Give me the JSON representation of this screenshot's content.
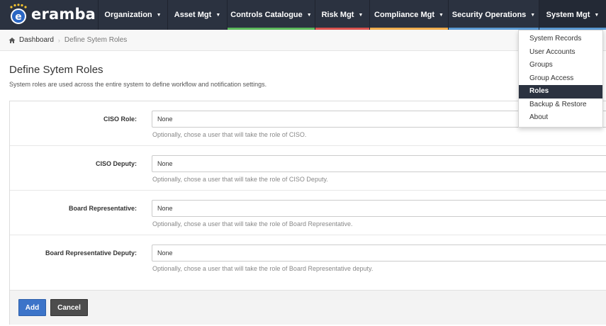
{
  "app": {
    "logo_text": "eramba"
  },
  "nav": {
    "items": [
      {
        "label": "Organization",
        "accent": ""
      },
      {
        "label": "Asset Mgt",
        "accent": ""
      },
      {
        "label": "Controls Catalogue",
        "accent": "#5cb85c"
      },
      {
        "label": "Risk Mgt",
        "accent": "#d9534f"
      },
      {
        "label": "Compliance Mgt",
        "accent": "#f0ad4e"
      },
      {
        "label": "Security Operations",
        "accent": "#5b9bd5"
      },
      {
        "label": "System Mgt",
        "accent": "#5b9bd5"
      }
    ]
  },
  "breadcrumb": {
    "home": "Dashboard",
    "current": "Define Sytem Roles"
  },
  "page": {
    "title": "Define Sytem Roles",
    "description": "System roles are used across the entire system to define workflow and notification settings."
  },
  "form": {
    "fields": [
      {
        "label": "CISO Role:",
        "value": "None",
        "help": "Optionally, chose a user that will take the role of CISO."
      },
      {
        "label": "CISO Deputy:",
        "value": "None",
        "help": "Optionally, chose a user that will take the role of CISO Deputy."
      },
      {
        "label": "Board Representative:",
        "value": "None",
        "help": "Optionally, chose a user that will take the role of Board Representative."
      },
      {
        "label": "Board Representative Deputy:",
        "value": "None",
        "help": "Optionally, chose a user that will take the role of Board Representative deputy."
      }
    ],
    "add_label": "Add",
    "cancel_label": "Cancel"
  },
  "dropdown": {
    "items": [
      "System Records",
      "User Accounts",
      "Groups",
      "Group Access",
      "Roles",
      "Backup & Restore",
      "About"
    ],
    "active": "Roles"
  },
  "colors": {
    "navbar": "#2b3240",
    "primary": "#3c74c9"
  }
}
